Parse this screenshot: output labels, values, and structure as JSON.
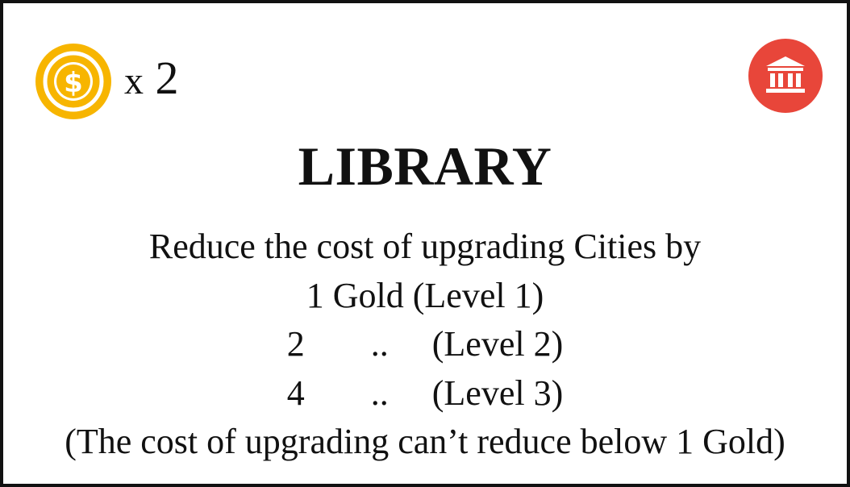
{
  "card": {
    "cost": {
      "icon": "gold-coin-icon",
      "multiplier_prefix": "x",
      "amount": "2"
    },
    "type_icon": "building-icon",
    "colors": {
      "coin": "#f7b500",
      "coin_inner": "#ffc20e",
      "type_badge": "#e8463a",
      "border": "#111111"
    },
    "title": "LIBRARY",
    "description": {
      "line1": "Reduce the cost of upgrading Cities by",
      "line2": "1 Gold (Level 1)",
      "levels": [
        {
          "amount": "2",
          "ditto": "..",
          "level": "(Level 2)"
        },
        {
          "amount": "4",
          "ditto": "..",
          "level": "(Level 3)"
        }
      ],
      "note": "(The cost of upgrading can’t reduce below 1 Gold)"
    }
  }
}
